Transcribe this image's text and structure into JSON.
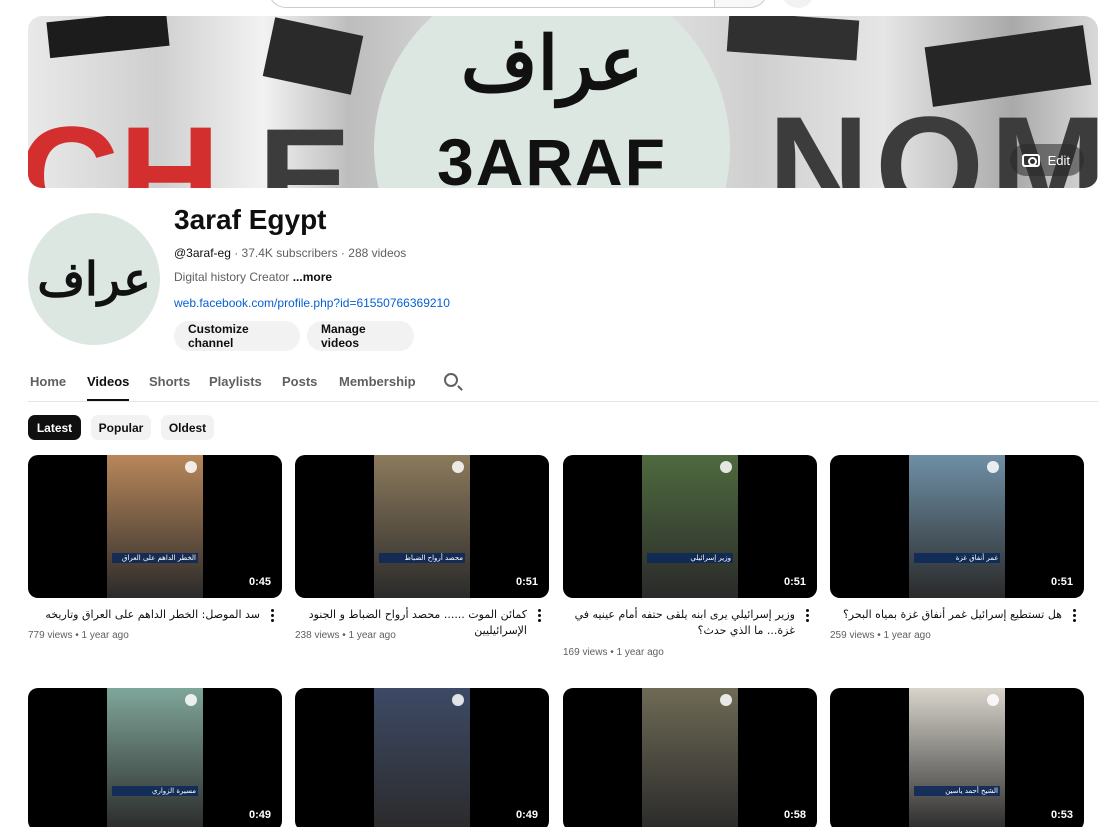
{
  "banner": {
    "arabic_logo": "عراف",
    "latin_logo": "3ARAF",
    "edit_label": "Edit"
  },
  "channel": {
    "avatar_text": "عراف",
    "name": "3araf Egypt",
    "handle": "@3araf-eg",
    "stats": " · 37.4K subscribers · 288 videos",
    "description": "Digital history Creator ",
    "more_label": "...more",
    "link": "web.facebook.com/profile.php?id=61550766369210",
    "customize_label": "Customize channel",
    "manage_label": "Manage videos"
  },
  "tabs": [
    "Home",
    "Videos",
    "Shorts",
    "Playlists",
    "Posts",
    "Membership"
  ],
  "active_tab": "Videos",
  "chips": [
    "Latest",
    "Popular",
    "Oldest"
  ],
  "active_chip": "Latest",
  "videos": [
    {
      "title": "سد الموصل: الخطر الداهم على العراق وتاريخه",
      "views": "779 views",
      "age": "1 year ago",
      "duration": "0:45",
      "color": "#b9875a"
    },
    {
      "title": "كمائن الموت ...... محصد أرواح الضباط و الجنود الإسرائيليين",
      "views": "238 views",
      "age": "1 year ago",
      "duration": "0:51",
      "color": "#8c7a5c"
    },
    {
      "title": "وزير إسرائيلي يرى ابنه يلقى حتفه أمام عينيه في غزة... ما الذي حدث؟",
      "views": "169 views",
      "age": "1 year ago",
      "duration": "0:51",
      "color": "#4f6a3e"
    },
    {
      "title": "هل تستطيع إسرائيل غمر أنفاق غزة بمياه البحر؟",
      "views": "259 views",
      "age": "1 year ago",
      "duration": "0:51",
      "color": "#6f8fa5"
    },
    {
      "title": "مسيرة الزواري",
      "views": "",
      "age": "",
      "duration": "0:49",
      "color": "#7fa69a"
    },
    {
      "title": "",
      "views": "",
      "age": "",
      "duration": "0:49",
      "color": "#3d4a66"
    },
    {
      "title": "",
      "views": "",
      "age": "",
      "duration": "0:58",
      "color": "#6e6a55"
    },
    {
      "title": "الشيخ أحمد ياسين",
      "views": "",
      "age": "",
      "duration": "0:53",
      "color": "#d8d4cc"
    }
  ],
  "thumb_captions": [
    "الخطر الداهم على العراق",
    "محصد أرواح الضباط",
    "وزير إسرائيلي",
    "غمر أنفاق غزة",
    "مسيرة الزواري",
    "",
    "",
    "الشيخ أحمد ياسين"
  ]
}
